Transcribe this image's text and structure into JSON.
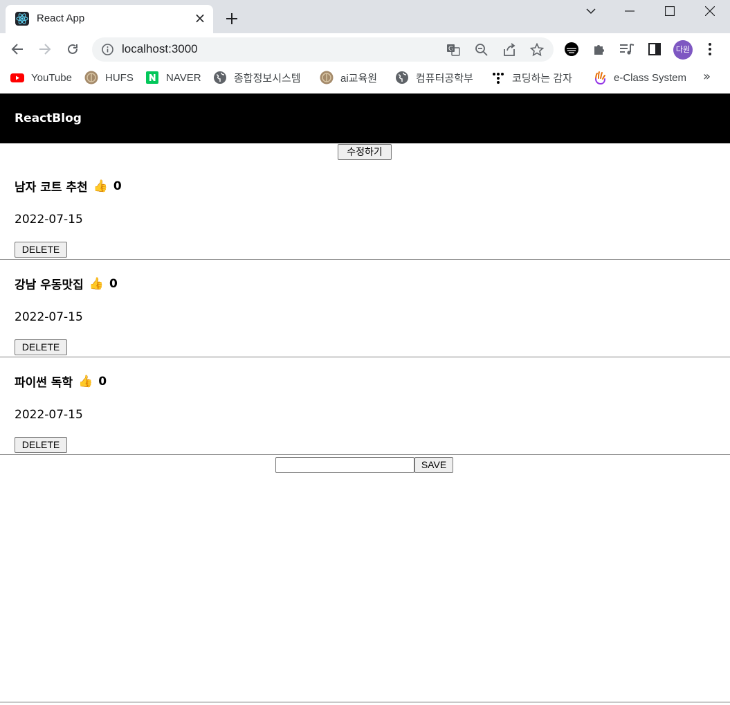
{
  "browser": {
    "tab_title": "React App",
    "url": "localhost:3000",
    "avatar_text": "다원",
    "bookmarks": [
      {
        "label": "YouTube",
        "icon": "youtube-icon"
      },
      {
        "label": "HUFS",
        "icon": "hufs-icon"
      },
      {
        "label": "NAVER",
        "icon": "naver-icon"
      },
      {
        "label": "종합정보시스템",
        "icon": "globe-icon"
      },
      {
        "label": "ai교육원",
        "icon": "hufs-icon"
      },
      {
        "label": "컴퓨터공학부",
        "icon": "globe-icon"
      },
      {
        "label": "코딩하는 감자",
        "icon": "dots-icon"
      },
      {
        "label": "e-Class System",
        "icon": "hand-icon"
      }
    ],
    "bookmarks_more": "»"
  },
  "app": {
    "title": "ReactBlog",
    "edit_button": "수정하기",
    "posts": [
      {
        "title": "남자 코트 추천",
        "thumb": "👍",
        "likes": "0",
        "date": "2022-07-15",
        "delete_label": "DELETE"
      },
      {
        "title": "강남 우동맛집",
        "thumb": "👍",
        "likes": "0",
        "date": "2022-07-15",
        "delete_label": "DELETE"
      },
      {
        "title": "파이썬 독학",
        "thumb": "👍",
        "likes": "0",
        "date": "2022-07-15",
        "delete_label": "DELETE"
      }
    ],
    "new_post_input": "",
    "save_label": "SAVE"
  }
}
